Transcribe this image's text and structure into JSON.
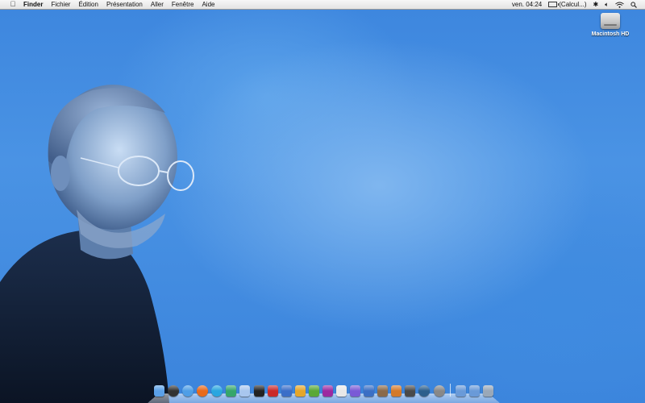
{
  "menubar": {
    "apple": "",
    "app_name": "Finder",
    "menus": [
      "Fichier",
      "Édition",
      "Présentation",
      "Aller",
      "Fenêtre",
      "Aide"
    ],
    "clock": "ven. 04:24",
    "battery": "(Calcul...)"
  },
  "desktop": {
    "icons": [
      {
        "label": "Macintosh HD",
        "icon": "hard-drive-icon"
      }
    ]
  },
  "dock": {
    "apps": [
      {
        "icon": "finder-icon",
        "color": "#5aa0e8"
      },
      {
        "icon": "dashboard-icon",
        "color": "#333333"
      },
      {
        "icon": "safari-icon",
        "color": "#4f9ee6"
      },
      {
        "icon": "firefox-icon",
        "color": "#e86a1c"
      },
      {
        "icon": "skype-icon",
        "color": "#2aa6e0"
      },
      {
        "icon": "messenger-icon",
        "color": "#36a66b"
      },
      {
        "icon": "itunes-icon",
        "color": "#a8c6ee"
      },
      {
        "icon": "frontrow-icon",
        "color": "#222222"
      },
      {
        "icon": "adobe-app-icon",
        "color": "#c92a2a"
      },
      {
        "icon": "ical-icon",
        "color": "#3a6ec8"
      },
      {
        "icon": "folder-app-icon",
        "color": "#e5a62a"
      },
      {
        "icon": "dreamweaver-icon",
        "color": "#5aa835"
      },
      {
        "icon": "indesign-icon",
        "color": "#9c2aa0"
      },
      {
        "icon": "calendar-icon",
        "color": "#e8e8e8"
      },
      {
        "icon": "itunes-purple-icon",
        "color": "#7a5ad6"
      },
      {
        "icon": "word-icon",
        "color": "#3b6fc4"
      },
      {
        "icon": "photo-icon",
        "color": "#8a6a4a"
      },
      {
        "icon": "keynote-icon",
        "color": "#d47a2a"
      },
      {
        "icon": "utility-icon",
        "color": "#4a4a4a"
      },
      {
        "icon": "timemachine-icon",
        "color": "#2c5f8c"
      },
      {
        "icon": "system-preferences-icon",
        "color": "#888888"
      }
    ],
    "right_items": [
      {
        "icon": "applications-folder-icon",
        "color": "#6a9ad8"
      },
      {
        "icon": "downloads-folder-icon",
        "color": "#6a9ad8"
      },
      {
        "icon": "trash-icon",
        "color": "#9aa8b8"
      }
    ]
  }
}
